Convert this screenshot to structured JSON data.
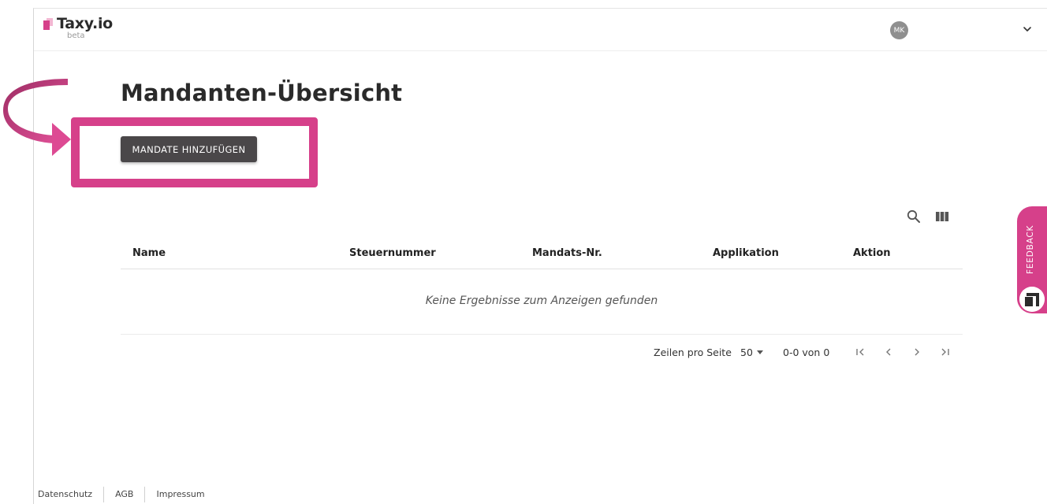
{
  "header": {
    "logo_text": "Taxy.io",
    "logo_badge": "beta",
    "avatar_initials": "MK"
  },
  "main": {
    "title": "Mandanten-Übersicht",
    "add_button_label": "MANDATE HINZUFÜGEN"
  },
  "table": {
    "columns": [
      "Name",
      "Steuernummer",
      "Mandats-Nr.",
      "Applikation",
      "Aktion"
    ],
    "empty_message": "Keine Ergebnisse zum Anzeigen gefunden"
  },
  "pagination": {
    "rows_per_page_label": "Zeilen pro Seite",
    "rows_per_page_value": "50",
    "range_text": "0-0 von 0"
  },
  "footer": {
    "links": [
      "Datenschutz",
      "AGB",
      "Impressum"
    ]
  },
  "feedback": {
    "label": "FEEDBACK"
  },
  "colors": {
    "accent": "#d6408a",
    "button_bg": "#4a4749"
  }
}
